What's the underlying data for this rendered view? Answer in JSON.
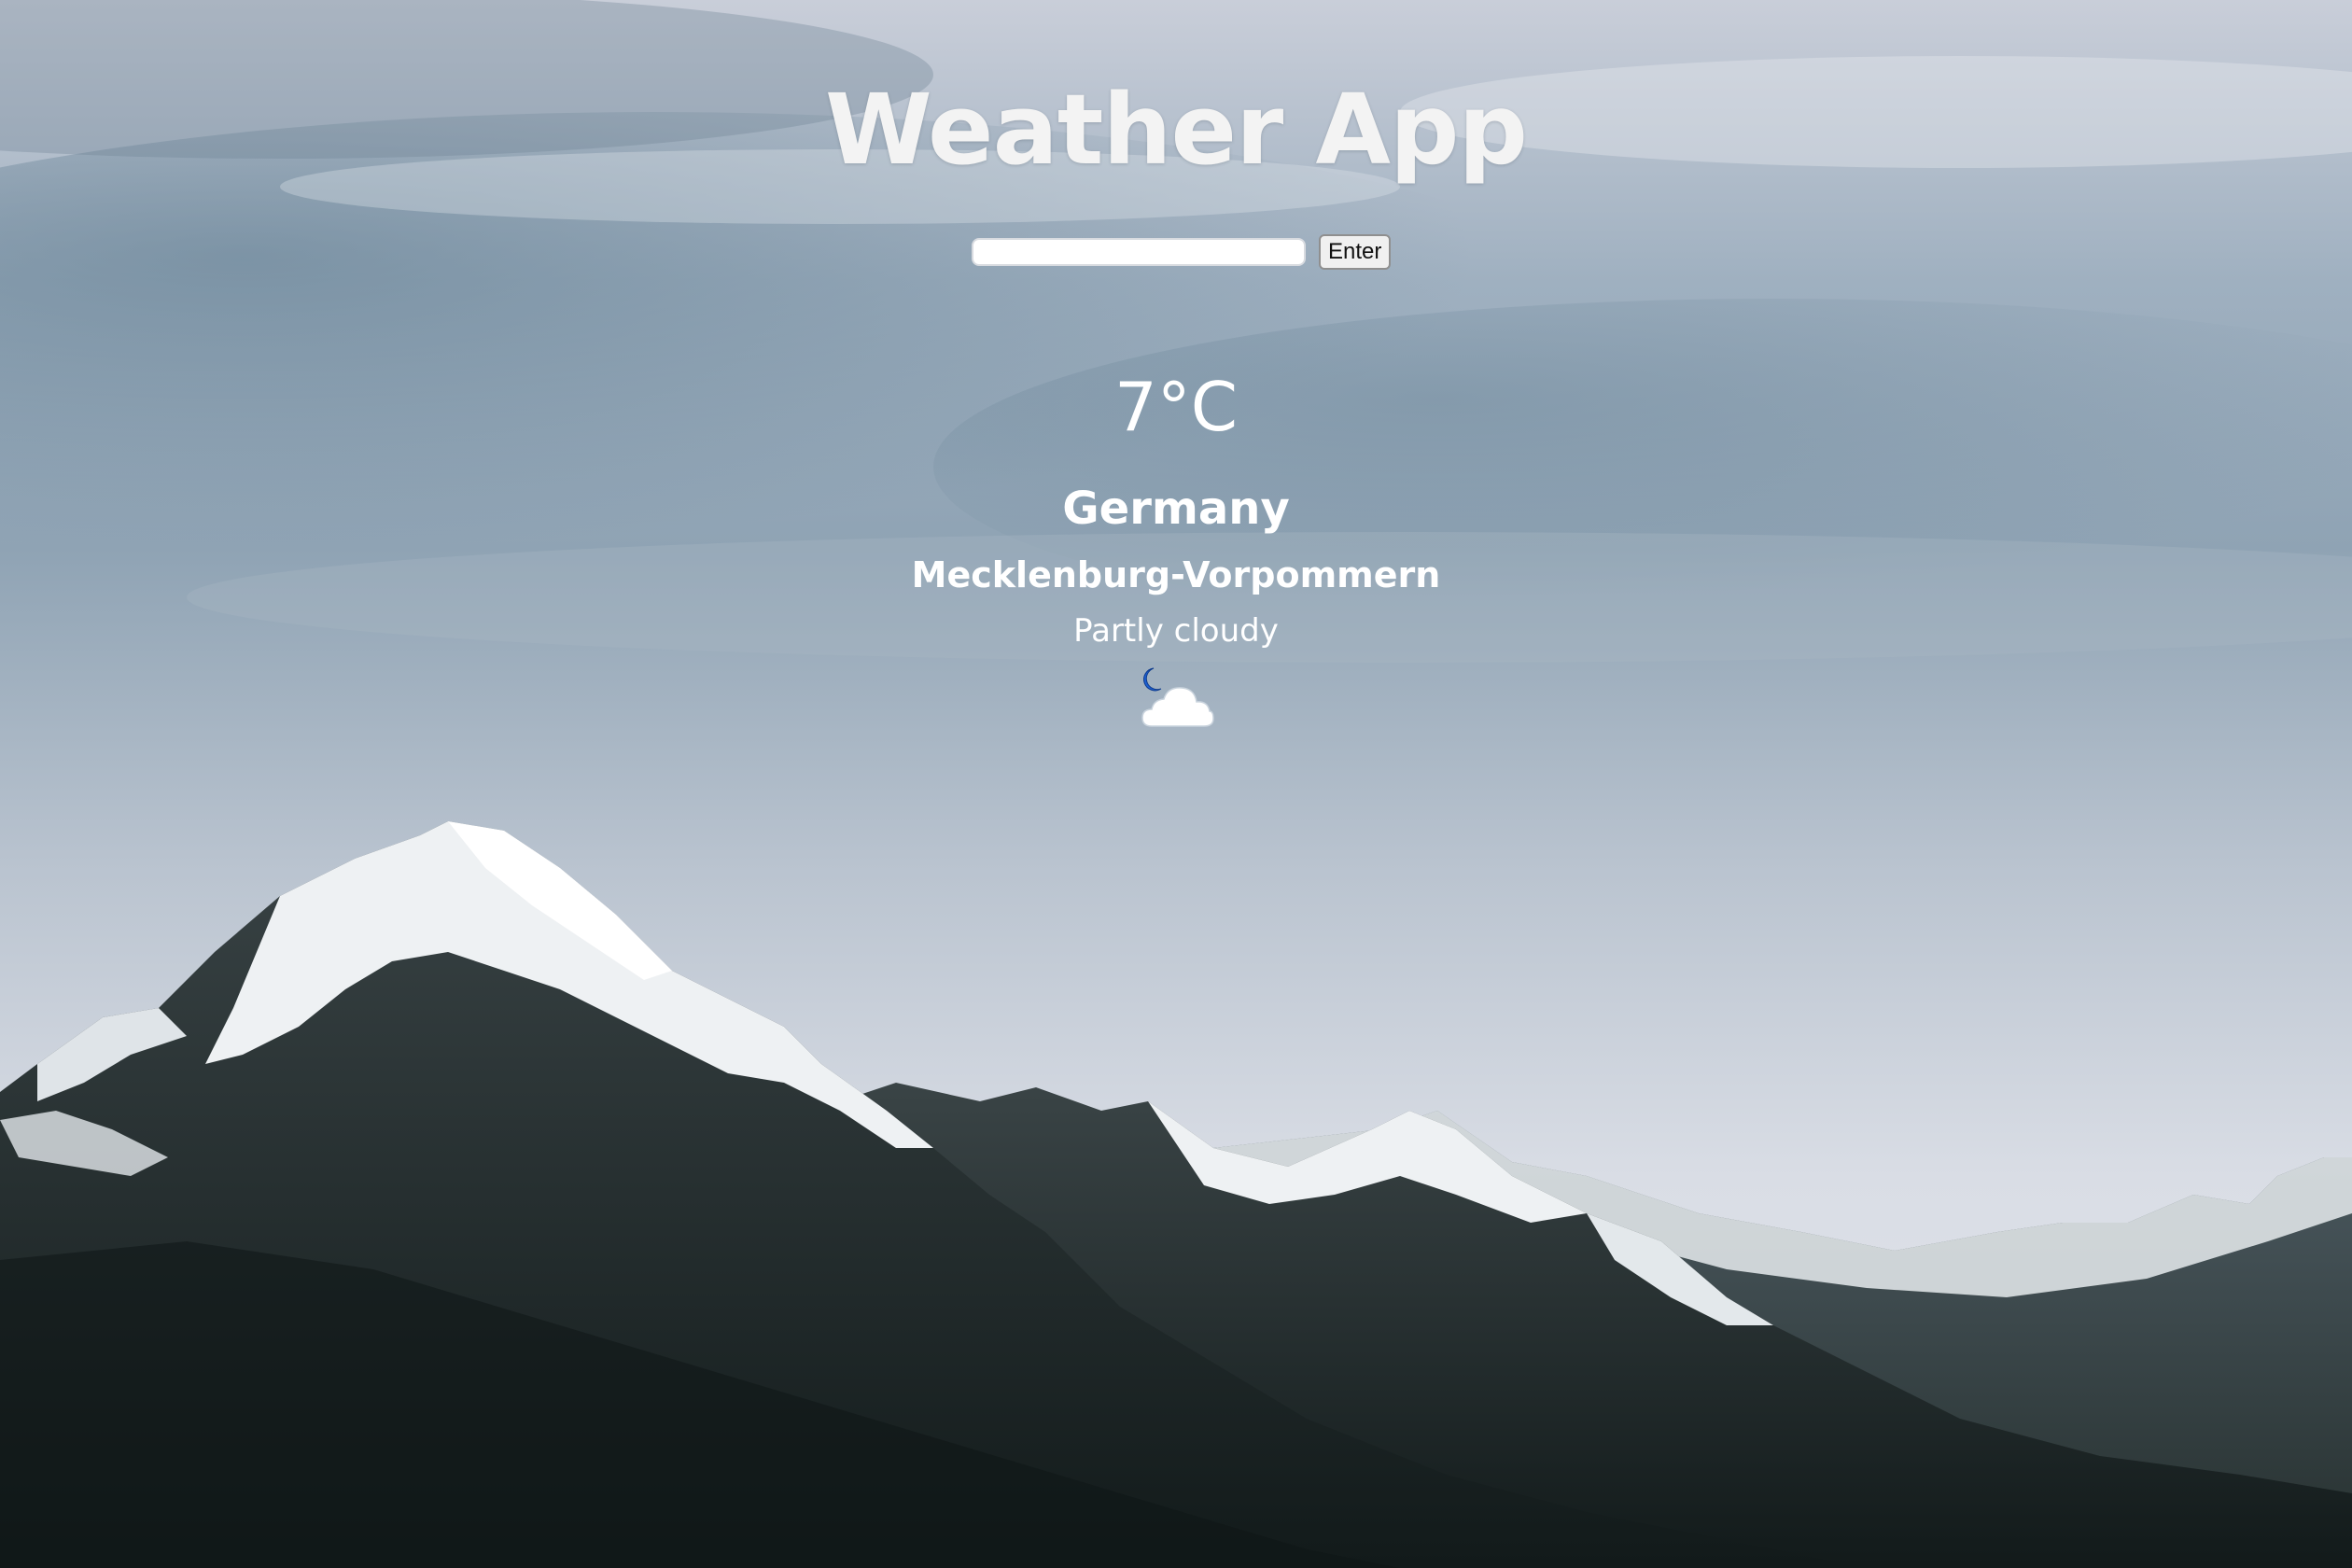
{
  "app": {
    "title": "Weather App"
  },
  "search": {
    "value": "",
    "placeholder": "",
    "button_label": "Enter"
  },
  "weather": {
    "temperature": "7°C",
    "country": "Germany",
    "region": "Mecklenburg-Vorpommern",
    "condition": "Partly cloudy",
    "icon": "partly-cloudy-night-icon"
  },
  "colors": {
    "text": "#ffffff",
    "sky": "#aebccb",
    "mountain_dark": "#1c2424",
    "snow": "#eef1f3"
  }
}
